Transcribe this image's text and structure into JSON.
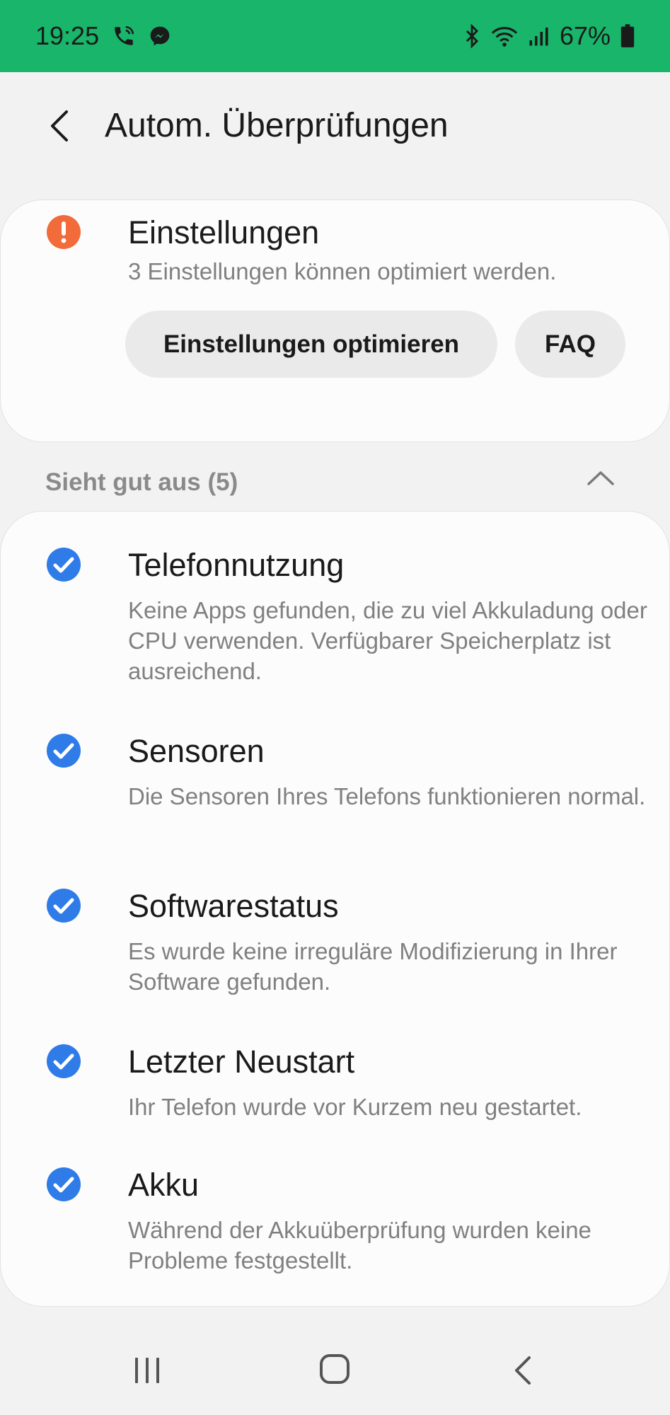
{
  "status_bar": {
    "time": "19:25",
    "battery": "67%",
    "bg_color": "#18b56b",
    "icons_left": [
      "phone-wifi-call-icon",
      "messenger-icon"
    ],
    "icons_right": [
      "bluetooth-icon",
      "wifi-icon",
      "signal-icon",
      "battery-icon"
    ]
  },
  "header": {
    "title": "Autom. Überprüfungen"
  },
  "settings_card": {
    "title": "Einstellungen",
    "subtitle": "3 Einstellungen können optimiert werden.",
    "optimize_label": "Einstellungen optimieren",
    "faq_label": "FAQ",
    "warning_color": "#f26b3a"
  },
  "section": {
    "header": "Sieht gut aus (5)"
  },
  "checks": [
    {
      "title": "Telefonnutzung",
      "desc": "Keine Apps gefunden, die zu viel Akkuladung oder CPU verwenden. Verfügbarer Speicherplatz ist ausreichend."
    },
    {
      "title": "Sensoren",
      "desc": "Die Sensoren Ihres Telefons funktionieren normal."
    },
    {
      "title": "Softwarestatus",
      "desc": "Es wurde keine irreguläre Modifizierung in Ihrer Software gefunden."
    },
    {
      "title": "Letzter Neustart",
      "desc": "Ihr Telefon wurde vor Kurzem neu gestartet."
    },
    {
      "title": "Akku",
      "desc": "Während der Akkuüberprüfung wurden keine Probleme festgestellt."
    }
  ],
  "colors": {
    "check_blue": "#2f7be8"
  }
}
